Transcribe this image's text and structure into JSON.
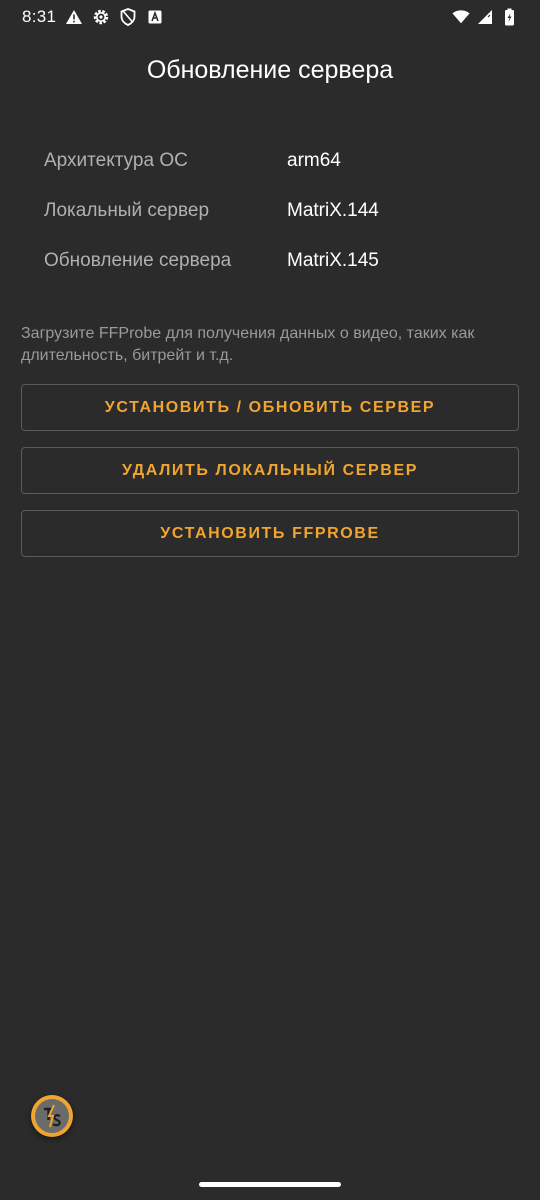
{
  "status_bar": {
    "time": "8:31",
    "left_icons": [
      "warning-icon",
      "settings-icon",
      "shield-icon",
      "app-notification-icon"
    ],
    "right_icons": [
      "wifi-icon",
      "signal-icon",
      "battery-icon"
    ]
  },
  "header": {
    "title": "Обновление сервера"
  },
  "info": {
    "rows": [
      {
        "label": "Архитектура ОС",
        "value": "arm64"
      },
      {
        "label": "Локальный сервер",
        "value": "MatriX.144"
      },
      {
        "label": "Обновление сервера",
        "value": "MatriX.145"
      }
    ]
  },
  "description": "Загрузите FFProbe для получения данных о видео, таких как длительность, битрейт и т.д.",
  "buttons": {
    "install": "УСТАНОВИТЬ / ОБНОВИТЬ СЕРВЕР",
    "delete": "УДАЛИТЬ ЛОКАЛЬНЫЙ СЕРВЕР",
    "ffprobe": "УСТАНОВИТЬ FFPROBE"
  },
  "colors": {
    "background": "#2b2b2b",
    "accent": "#f0a530",
    "label": "#b0b0b0",
    "description": "#9a9a9a",
    "button_border": "#5a5a5a"
  },
  "fab": {
    "icon": "ts-app-icon"
  }
}
